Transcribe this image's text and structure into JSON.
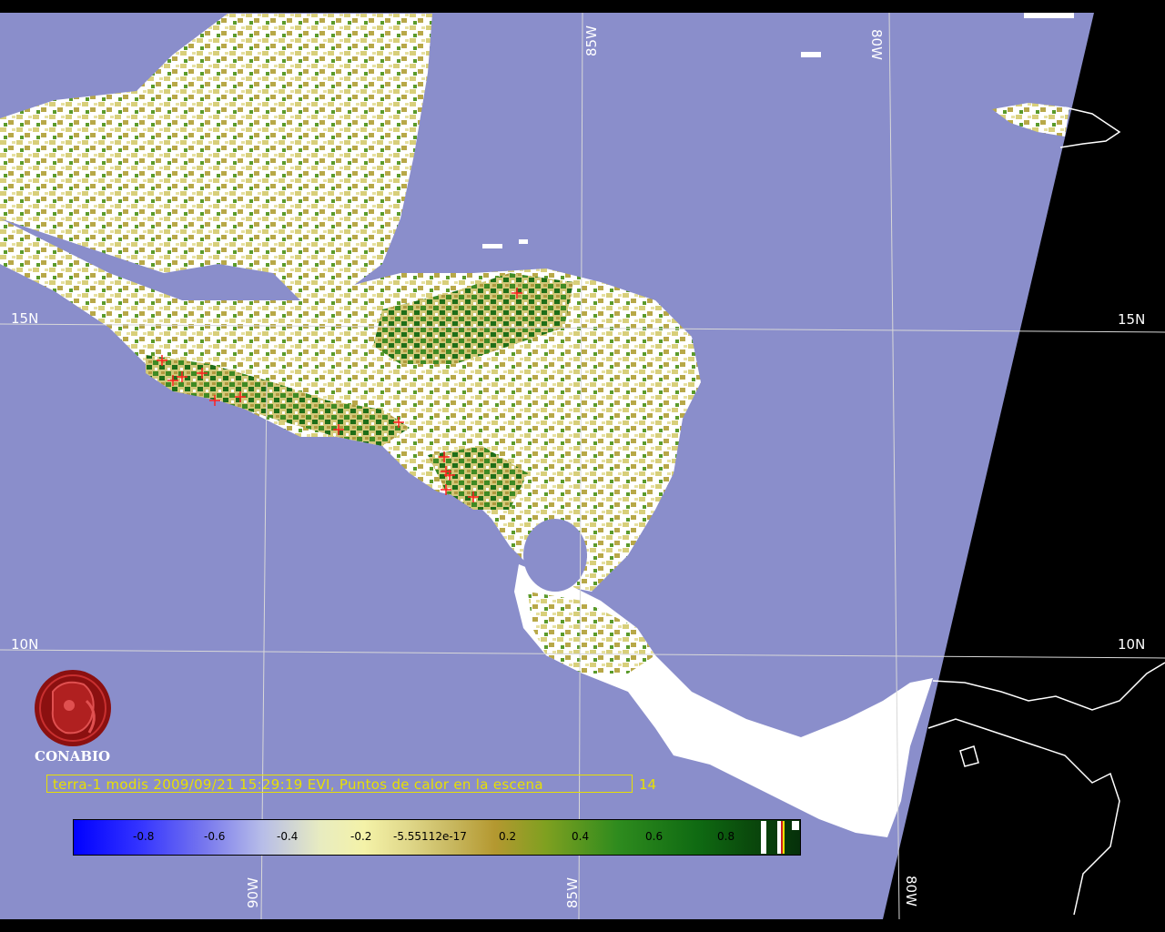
{
  "grid_labels": {
    "lat_15n_left": "15N",
    "lat_15n_right": "15N",
    "lat_10n_left": "10N",
    "lat_10n_right": "10N",
    "lon_85w_top": "85W",
    "lon_80w_top": "80W",
    "lon_90w_bottom": "90W",
    "lon_85w_bottom": "85W",
    "lon_80w_bottom": "80W"
  },
  "logo": {
    "name": "CONABIO"
  },
  "caption": {
    "text": "terra-1 modis 2009/09/21 15:29:19 EVI, Puntos de calor en la escena",
    "count": "14"
  },
  "colorbar": {
    "ticks": [
      "-0.8",
      "-0.6",
      "-0.4",
      "-0.2",
      "-5.55112e-17",
      "0.2",
      "0.4",
      "0.6",
      "0.8"
    ]
  },
  "colors": {
    "ocean": "#8a8ecb",
    "no_data": "#000000",
    "cloud": "#ffffff",
    "fire_marker": "#ff2020",
    "caption": "#e8e000"
  },
  "hotspot_count": 14
}
